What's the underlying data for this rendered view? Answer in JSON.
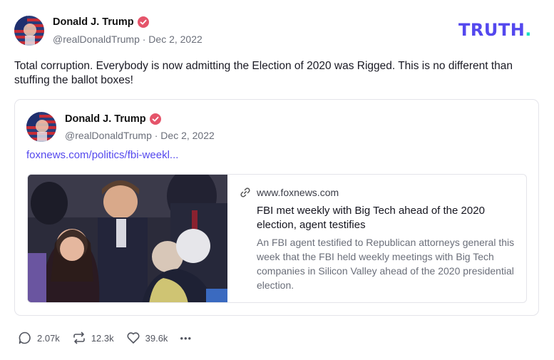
{
  "post": {
    "author_name": "Donald J. Trump",
    "author_handle": "@realDonaldTrump · Dec 2, 2022",
    "text": "Total corruption. Everybody is now admitting the Election of 2020 was Rigged. This is no different than stuffing the ballot boxes!",
    "verified_icon": "verified-badge-icon"
  },
  "brand": {
    "logo_text": "TRUTH",
    "logo_dot": ".",
    "accent_color": "#5448ee",
    "dot_color": "#15e0c2"
  },
  "quoted": {
    "author_name": "Donald J. Trump",
    "author_handle": "@realDonaldTrump · Dec 2, 2022",
    "link_text": "foxnews.com/politics/fbi-weekl...",
    "card": {
      "domain": "www.foxnews.com",
      "title": "FBI met weekly with Big Tech ahead of the 2020 election, agent testifies",
      "description": "An FBI agent testified to Republican attorneys general this week that the FBI held weekly meetings with Big Tech companies in Silicon Valley ahead of the 2020 presidential election."
    }
  },
  "actions": {
    "replies": "2.07k",
    "retruths": "12.3k",
    "likes": "39.6k",
    "more": "•••"
  }
}
